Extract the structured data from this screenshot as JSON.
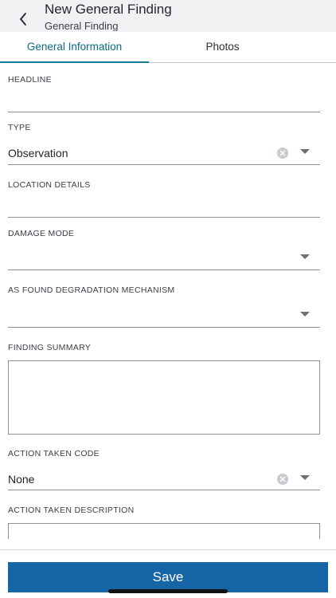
{
  "header": {
    "title": "New General Finding",
    "subtitle": "General Finding"
  },
  "tabs": [
    {
      "label": "General Information",
      "active": true
    },
    {
      "label": "Photos",
      "active": false
    }
  ],
  "form": {
    "headline": {
      "label": "HEADLINE",
      "value": ""
    },
    "type": {
      "label": "TYPE",
      "value": "Observation"
    },
    "location_details": {
      "label": "LOCATION DETAILS",
      "value": ""
    },
    "damage_mode": {
      "label": "DAMAGE MODE",
      "value": ""
    },
    "degradation_mechanism": {
      "label": "AS FOUND DEGRADATION MECHANISM",
      "value": ""
    },
    "finding_summary": {
      "label": "FINDING SUMMARY",
      "value": ""
    },
    "action_taken_code": {
      "label": "ACTION TAKEN CODE",
      "value": "None"
    },
    "action_taken_description": {
      "label": "ACTION TAKEN DESCRIPTION",
      "value": ""
    }
  },
  "footer": {
    "save_label": "Save"
  },
  "icons": {
    "back": "chevron-left-icon",
    "clear": "clear-circle-icon",
    "dropdown": "caret-down-icon"
  },
  "colors": {
    "accent": "#1b7a90",
    "primary_button": "#1565a7",
    "header_bg": "#f0f1f3"
  }
}
